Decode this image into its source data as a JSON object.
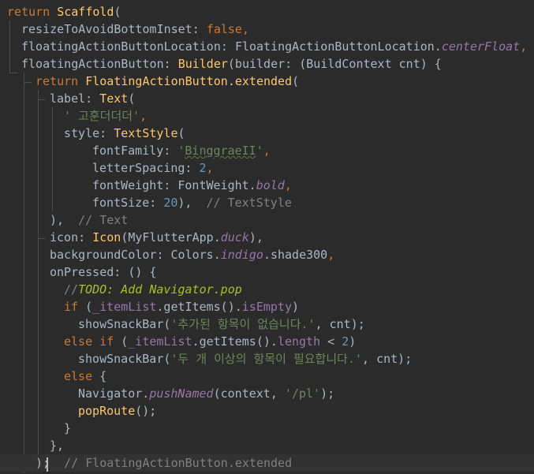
{
  "editor": {
    "lines": [
      {
        "indent": 9,
        "tokens": [
          {
            "t": "return ",
            "c": "tok-kw"
          },
          {
            "t": "Scaffold",
            "c": "tok-fn"
          },
          {
            "t": "(",
            "c": "tok-plain"
          }
        ]
      },
      {
        "indent": 27,
        "tokens": [
          {
            "t": "resizeToAvoidBottomInset: ",
            "c": "tok-prop"
          },
          {
            "t": "false",
            "c": "tok-kw"
          },
          {
            "t": ",",
            "c": "tok-kw"
          }
        ]
      },
      {
        "indent": 27,
        "tokens": [
          {
            "t": "floatingActionButtonLocation: ",
            "c": "tok-prop"
          },
          {
            "t": "FloatingActionButtonLocation.",
            "c": "tok-plain"
          },
          {
            "t": "centerFloat",
            "c": "tok-static"
          },
          {
            "t": ",",
            "c": "tok-kw"
          }
        ]
      },
      {
        "indent": 27,
        "tokens": [
          {
            "t": "floatingActionButton: ",
            "c": "tok-prop"
          },
          {
            "t": "Builder",
            "c": "tok-fn"
          },
          {
            "t": "(builder: (BuildContext cnt) {",
            "c": "tok-plain"
          }
        ]
      },
      {
        "indent": 45,
        "tokens": [
          {
            "t": "return ",
            "c": "tok-kw"
          },
          {
            "t": "FloatingActionButton.extended",
            "c": "tok-fn"
          },
          {
            "t": "(",
            "c": "tok-plain"
          }
        ]
      },
      {
        "indent": 63,
        "tokens": [
          {
            "t": "label: ",
            "c": "tok-prop"
          },
          {
            "t": "Text",
            "c": "tok-fn"
          },
          {
            "t": "(",
            "c": "tok-plain"
          }
        ]
      },
      {
        "indent": 81,
        "tokens": [
          {
            "t": "' 고훈더더더'",
            "c": "tok-str"
          },
          {
            "t": ",",
            "c": "tok-kw"
          }
        ]
      },
      {
        "indent": 81,
        "tokens": [
          {
            "t": "style: ",
            "c": "tok-prop"
          },
          {
            "t": "TextStyle",
            "c": "tok-fn"
          },
          {
            "t": "(",
            "c": "tok-plain"
          }
        ]
      },
      {
        "indent": 117,
        "tokens": [
          {
            "t": "fontFamily: ",
            "c": "tok-prop"
          },
          {
            "t": "'",
            "c": "tok-str"
          },
          {
            "t": "BinggraeII",
            "c": "tok-str-underline"
          },
          {
            "t": "'",
            "c": "tok-str"
          },
          {
            "t": ",",
            "c": "tok-kw"
          }
        ]
      },
      {
        "indent": 117,
        "tokens": [
          {
            "t": "letterSpacing: ",
            "c": "tok-prop"
          },
          {
            "t": "2",
            "c": "tok-num"
          },
          {
            "t": ",",
            "c": "tok-kw"
          }
        ]
      },
      {
        "indent": 117,
        "tokens": [
          {
            "t": "fontWeight: ",
            "c": "tok-prop"
          },
          {
            "t": "FontWeight.",
            "c": "tok-plain"
          },
          {
            "t": "bold",
            "c": "tok-static"
          },
          {
            "t": ",",
            "c": "tok-kw"
          }
        ]
      },
      {
        "indent": 117,
        "tokens": [
          {
            "t": "fontSize: ",
            "c": "tok-prop"
          },
          {
            "t": "20",
            "c": "tok-num"
          },
          {
            "t": "),  ",
            "c": "tok-plain"
          },
          {
            "t": "// TextStyle",
            "c": "tok-comment"
          }
        ]
      },
      {
        "indent": 63,
        "tokens": [
          {
            "t": "),  ",
            "c": "tok-plain"
          },
          {
            "t": "// Text",
            "c": "tok-comment"
          }
        ]
      },
      {
        "indent": 63,
        "tokens": [
          {
            "t": "icon: ",
            "c": "tok-prop"
          },
          {
            "t": "Icon",
            "c": "tok-fn"
          },
          {
            "t": "(MyFlutterApp.",
            "c": "tok-plain"
          },
          {
            "t": "duck",
            "c": "tok-static"
          },
          {
            "t": "),",
            "c": "tok-plain"
          }
        ]
      },
      {
        "indent": 63,
        "tokens": [
          {
            "t": "backgroundColor: ",
            "c": "tok-prop"
          },
          {
            "t": "Colors.",
            "c": "tok-plain"
          },
          {
            "t": "indigo",
            "c": "tok-static"
          },
          {
            "t": ".shade300",
            "c": "tok-plain"
          },
          {
            "t": ",",
            "c": "tok-kw"
          }
        ]
      },
      {
        "indent": 63,
        "tokens": [
          {
            "t": "onPressed: () {",
            "c": "tok-prop"
          }
        ]
      },
      {
        "indent": 81,
        "tokens": [
          {
            "t": "//",
            "c": "tok-comment"
          },
          {
            "t": "TODO: Add Navigator.pop",
            "c": "tok-todo"
          }
        ]
      },
      {
        "indent": 81,
        "tokens": [
          {
            "t": "if ",
            "c": "tok-kw"
          },
          {
            "t": "(",
            "c": "tok-plain"
          },
          {
            "t": "_itemList",
            "c": "tok-prop-purple"
          },
          {
            "t": ".getItems().",
            "c": "tok-plain"
          },
          {
            "t": "isEmpty",
            "c": "tok-prop-purple"
          },
          {
            "t": ")",
            "c": "tok-plain"
          }
        ]
      },
      {
        "indent": 99,
        "tokens": [
          {
            "t": "showSnackBar(",
            "c": "tok-plain"
          },
          {
            "t": "'추가된 항목이 없습니다.'",
            "c": "tok-str"
          },
          {
            "t": ", cnt);",
            "c": "tok-plain"
          }
        ]
      },
      {
        "indent": 81,
        "tokens": [
          {
            "t": "else if ",
            "c": "tok-kw"
          },
          {
            "t": "(",
            "c": "tok-plain"
          },
          {
            "t": "_itemList",
            "c": "tok-prop-purple"
          },
          {
            "t": ".getItems().",
            "c": "tok-plain"
          },
          {
            "t": "length",
            "c": "tok-prop-purple"
          },
          {
            "t": " < ",
            "c": "tok-plain"
          },
          {
            "t": "2",
            "c": "tok-num"
          },
          {
            "t": ")",
            "c": "tok-plain"
          }
        ]
      },
      {
        "indent": 99,
        "tokens": [
          {
            "t": "showSnackBar(",
            "c": "tok-plain"
          },
          {
            "t": "'두 개 이상의 항목이 필요합니다.'",
            "c": "tok-str"
          },
          {
            "t": ", cnt);",
            "c": "tok-plain"
          }
        ]
      },
      {
        "indent": 81,
        "tokens": [
          {
            "t": "else ",
            "c": "tok-kw"
          },
          {
            "t": "{",
            "c": "tok-plain"
          }
        ]
      },
      {
        "indent": 99,
        "tokens": [
          {
            "t": "Navigator.",
            "c": "tok-plain"
          },
          {
            "t": "pushNamed",
            "c": "tok-static"
          },
          {
            "t": "(context, ",
            "c": "tok-plain"
          },
          {
            "t": "'/pl'",
            "c": "tok-str"
          },
          {
            "t": ");",
            "c": "tok-plain"
          }
        ]
      },
      {
        "indent": 99,
        "tokens": [
          {
            "t": "popRoute",
            "c": "tok-fn"
          },
          {
            "t": "();",
            "c": "tok-plain"
          }
        ]
      },
      {
        "indent": 81,
        "tokens": [
          {
            "t": "}",
            "c": "tok-plain"
          }
        ]
      },
      {
        "indent": 63,
        "tokens": [
          {
            "t": "},",
            "c": "tok-plain"
          }
        ]
      },
      {
        "indent": 45,
        "tokens": [
          {
            "t": ");",
            "c": "tok-plain"
          },
          {
            "t": "  ",
            "c": "tok-plain"
          },
          {
            "t": "// FloatingActionButton.extended",
            "c": "tok-comment"
          }
        ]
      }
    ]
  },
  "colors": {
    "background": "#2B2B2B",
    "current_line": "#323232",
    "keyword": "#CC7832",
    "function": "#FFC66D",
    "string": "#6A8759",
    "number": "#6897BB",
    "comment": "#808080",
    "static_member": "#9876AA",
    "todo": "#A8C023",
    "text": "#A9B7C6"
  }
}
